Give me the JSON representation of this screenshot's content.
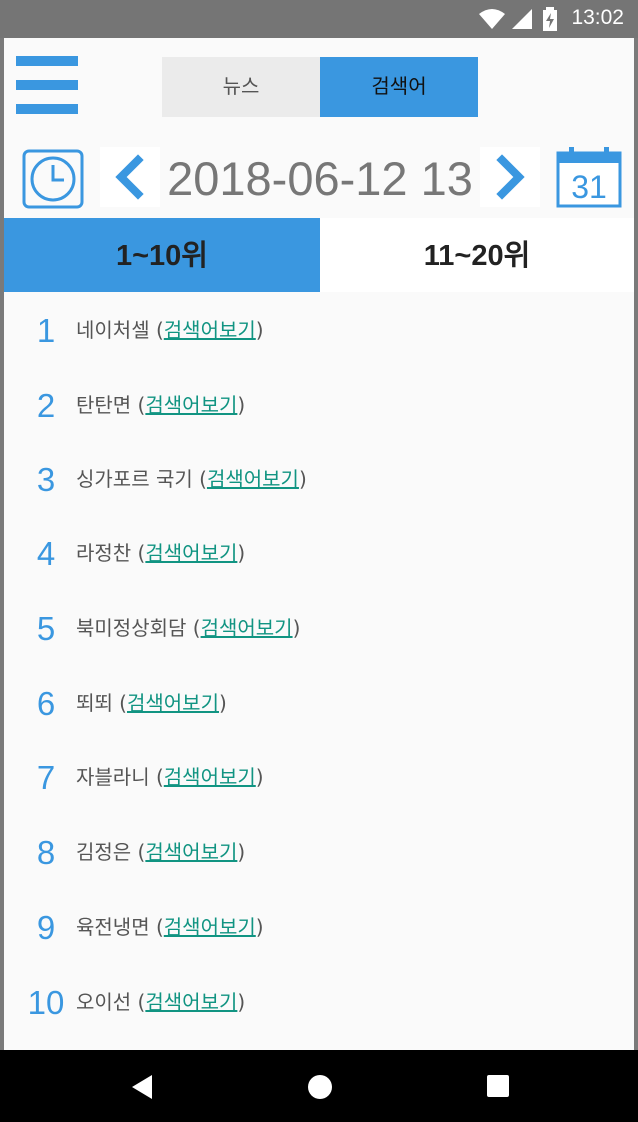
{
  "status_bar": {
    "time": "13:02"
  },
  "tabs": {
    "news": "뉴스",
    "search": "검색어"
  },
  "date_nav": {
    "date": "2018-06-12 13",
    "calendar_day": "31"
  },
  "rank_tabs": {
    "first": "1~10위",
    "second": "11~20위"
  },
  "link_label": "검색어보기",
  "items": [
    {
      "rank": "1",
      "keyword": "네이처셀"
    },
    {
      "rank": "2",
      "keyword": "탄탄면"
    },
    {
      "rank": "3",
      "keyword": "싱가포르 국기"
    },
    {
      "rank": "4",
      "keyword": "라정찬"
    },
    {
      "rank": "5",
      "keyword": "북미정상회담"
    },
    {
      "rank": "6",
      "keyword": "뙤뙤"
    },
    {
      "rank": "7",
      "keyword": "자블라니"
    },
    {
      "rank": "8",
      "keyword": "김정은"
    },
    {
      "rank": "9",
      "keyword": "육전냉면"
    },
    {
      "rank": "10",
      "keyword": "오이선"
    }
  ],
  "colors": {
    "accent": "#3a97e0",
    "link": "#119482",
    "tab_inactive": "#ebebeb"
  }
}
